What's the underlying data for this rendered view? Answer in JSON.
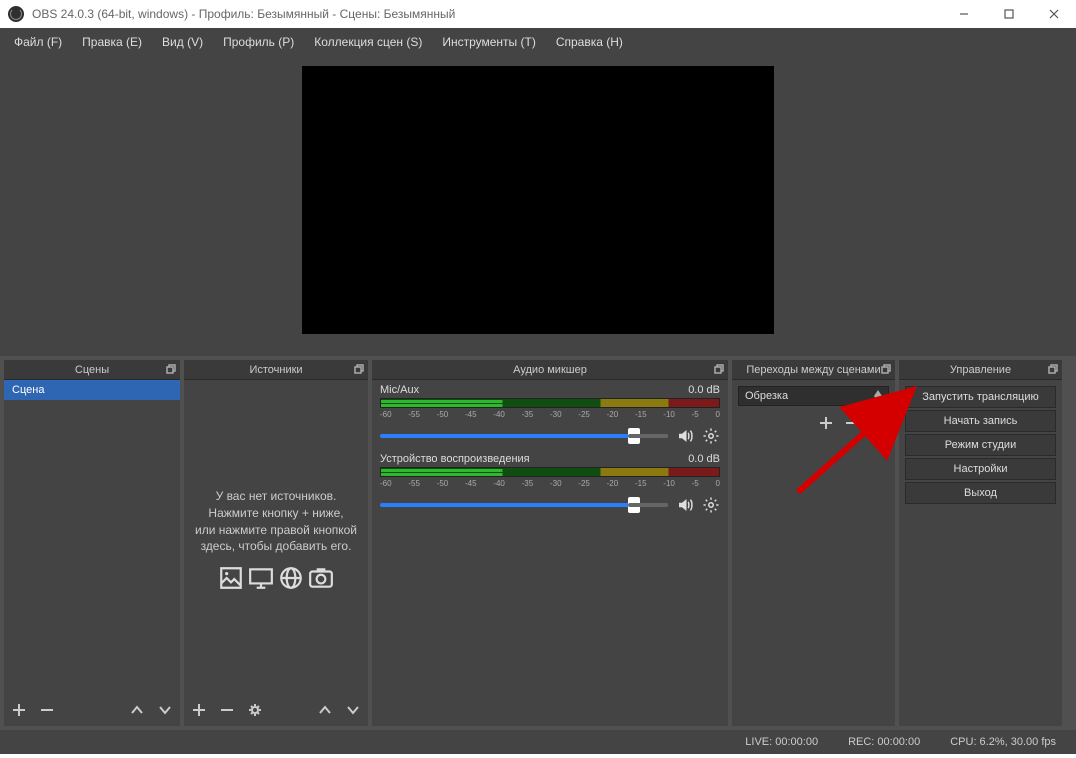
{
  "titlebar": {
    "title": "OBS 24.0.3 (64-bit, windows) - Профиль: Безымянный - Сцены: Безымянный"
  },
  "menu": {
    "file": "Файл (F)",
    "edit": "Правка (E)",
    "view": "Вид (V)",
    "profile": "Профиль (P)",
    "scene_collection": "Коллекция сцен (S)",
    "tools": "Инструменты (T)",
    "help": "Справка (H)"
  },
  "panels": {
    "scenes": {
      "title": "Сцены",
      "item": "Сцена"
    },
    "sources": {
      "title": "Источники",
      "empty_line1": "У вас нет источников.",
      "empty_line2": "Нажмите кнопку + ниже,",
      "empty_line3": "или нажмите правой кнопкой",
      "empty_line4": "здесь, чтобы добавить его."
    },
    "mixer": {
      "title": "Аудио микшер",
      "items": [
        {
          "name": "Mic/Aux",
          "level": "0.0 dB"
        },
        {
          "name": "Устройство воспроизведения",
          "level": "0.0 dB"
        }
      ],
      "ticks": [
        "-60",
        "-55",
        "-50",
        "-45",
        "-40",
        "-35",
        "-30",
        "-25",
        "-20",
        "-15",
        "-10",
        "-5",
        "0"
      ]
    },
    "transitions": {
      "title": "Переходы между сценами",
      "selected": "Обрезка"
    },
    "controls": {
      "title": "Управление",
      "buttons": {
        "start_stream": "Запустить трансляцию",
        "start_record": "Начать запись",
        "studio_mode": "Режим студии",
        "settings": "Настройки",
        "exit": "Выход"
      }
    }
  },
  "status": {
    "live": "LIVE: 00:00:00",
    "rec": "REC: 00:00:00",
    "cpu": "CPU: 6.2%, 30.00 fps"
  }
}
